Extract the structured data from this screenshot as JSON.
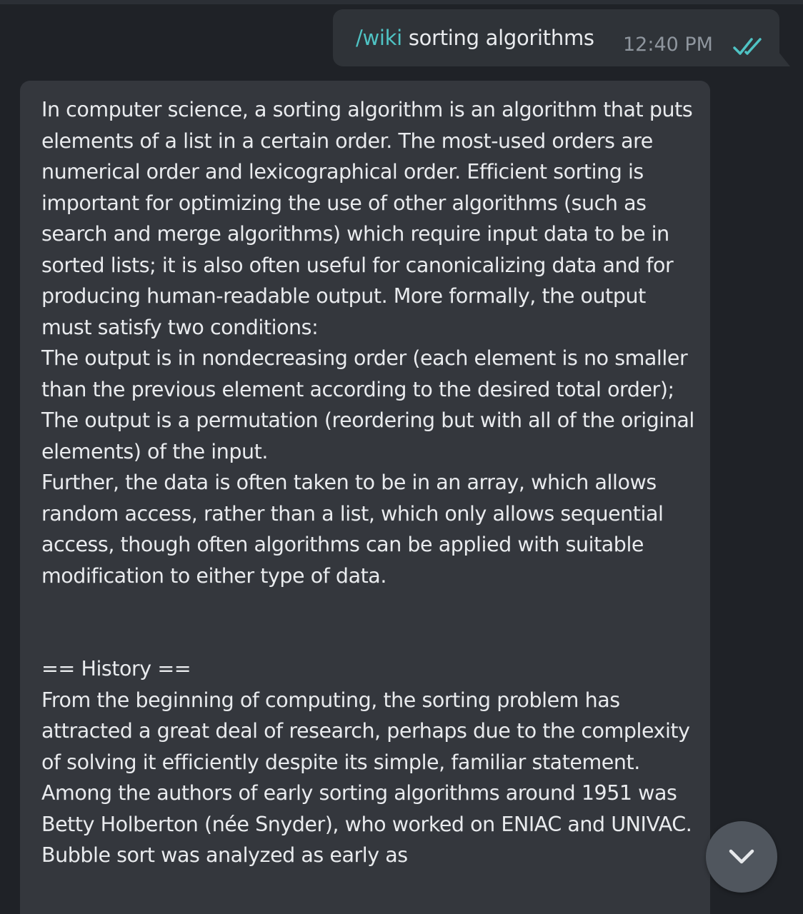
{
  "outgoing": {
    "command": "/wiki",
    "text": " sorting algorithms",
    "time": "12:40 PM",
    "status_icon": "double-check-icon",
    "command_color": "#4fc3c4"
  },
  "incoming": {
    "paragraphs": [
      "In computer science, a sorting algorithm is an algorithm that puts elements of a list in a certain order. The most-used orders are numerical order and lexicographical order. Efficient sorting is important for optimizing the use of other algorithms (such as search and merge algorithms) which require input data to be in sorted lists; it is also often useful for canonicalizing data and for producing human-readable output. More formally, the output must satisfy two conditions:",
      "The output is in nondecreasing order (each element is no smaller than the previous element according to the desired total order);",
      "The output is a permutation (reordering but with all of the original elements) of the input.",
      "Further, the data is often taken to be in an array, which allows random access, rather than a list, which only allows sequential access, though often algorithms can be applied with suitable modification to either type of data."
    ],
    "section_heading": "== History ==",
    "history_text": "From the beginning of computing, the sorting problem has attracted a great deal of research, perhaps due to the complexity of solving it efficiently despite its simple, familiar statement. Among the authors of early sorting algorithms around 1951 was Betty Holberton (née Snyder), who worked on ENIAC and UNIVAC. Bubble sort was analyzed as early as"
  },
  "scroll_button": {
    "icon": "chevron-down-icon"
  },
  "colors": {
    "background": "#1f2227",
    "bubble_in": "#34373d",
    "bubble_out": "#2f3338",
    "accent": "#4fc3c4",
    "timestamp": "#8f969e"
  }
}
